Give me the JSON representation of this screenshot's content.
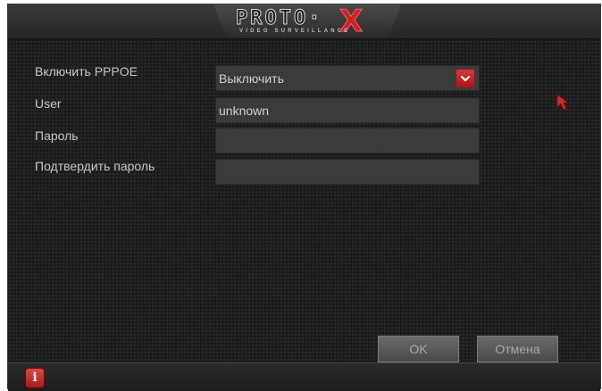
{
  "header": {
    "logo_main": "PROTO·",
    "logo_x": "X",
    "logo_sub": "VIDEO SURVEILLANCE"
  },
  "form": {
    "pppoe_label": "Включить PPPOE",
    "pppoe_value": "Выключить",
    "user_label": "User",
    "user_value": "unknown",
    "password_label": "Пароль",
    "password_value": "",
    "confirm_label": "Подтвердить пароль",
    "confirm_value": ""
  },
  "buttons": {
    "ok_label": "OK",
    "cancel_label": "Отмена"
  },
  "footer": {
    "info_label": "i"
  },
  "colors": {
    "accent": "#cc2222",
    "panel": "#1b1b1b",
    "field": "#3b3b3b",
    "text": "#c4c4c4"
  },
  "icons": {
    "dropdown": "chevron-down-icon",
    "cursor": "mouse-cursor-icon",
    "info": "info-icon"
  }
}
